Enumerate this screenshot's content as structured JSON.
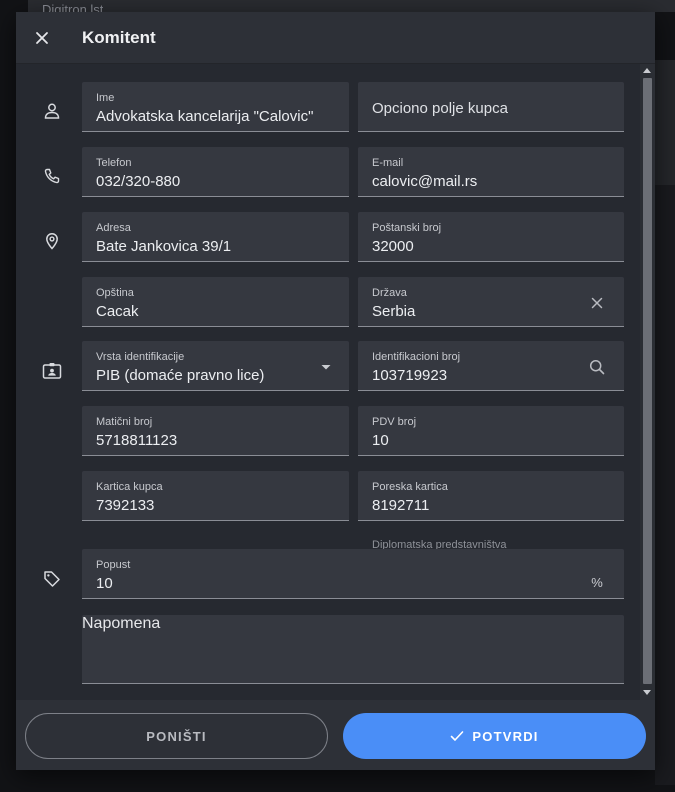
{
  "background": {
    "app_title": "Digitron lst"
  },
  "dialog": {
    "title": "Komitent",
    "close_icon": "close-icon"
  },
  "form": {
    "ime": {
      "label": "Ime",
      "value": "Advokatska kancelarija \"Calovic\""
    },
    "opciono": {
      "placeholder": "Opciono polje kupca"
    },
    "telefon": {
      "label": "Telefon",
      "value": "032/320-880"
    },
    "email": {
      "label": "E-mail",
      "value": "calovic@mail.rs"
    },
    "adresa": {
      "label": "Adresa",
      "value": "Bate Jankovica 39/1"
    },
    "postanski": {
      "label": "Poštanski broj",
      "value": "32000"
    },
    "opstina": {
      "label": "Opština",
      "value": "Cacak"
    },
    "drzava": {
      "label": "Država",
      "value": "Serbia"
    },
    "vrsta": {
      "label": "Vrsta identifikacije",
      "value": "PIB (domaće pravno lice)"
    },
    "identifikacioni": {
      "label": "Identifikacioni broj",
      "value": "103719923"
    },
    "maticni": {
      "label": "Matični broj",
      "value": "5718811123"
    },
    "pdv": {
      "label": "PDV broj",
      "value": "10"
    },
    "kartica": {
      "label": "Kartica kupca",
      "value": "7392133"
    },
    "poreska": {
      "label": "Poreska kartica",
      "value": "8192711",
      "hint": "Diplomatska predstavništva"
    },
    "popust": {
      "label": "Popust",
      "value": "10",
      "suffix": "%"
    },
    "napomena": {
      "placeholder": "Napomena"
    }
  },
  "icons": {
    "person": "person-icon",
    "phone": "phone-icon",
    "location": "location-pin-icon",
    "id_card": "id-card-icon",
    "tag": "tag-icon",
    "clear": "clear-icon",
    "dropdown": "dropdown-arrow-icon",
    "search": "search-icon",
    "check": "check-icon"
  },
  "footer": {
    "cancel_label": "PONIŠTI",
    "confirm_label": "POTVRDI"
  },
  "colors": {
    "accent": "#4a8ef7",
    "dialog_bg": "#2d3037",
    "field_bg": "#353840"
  }
}
